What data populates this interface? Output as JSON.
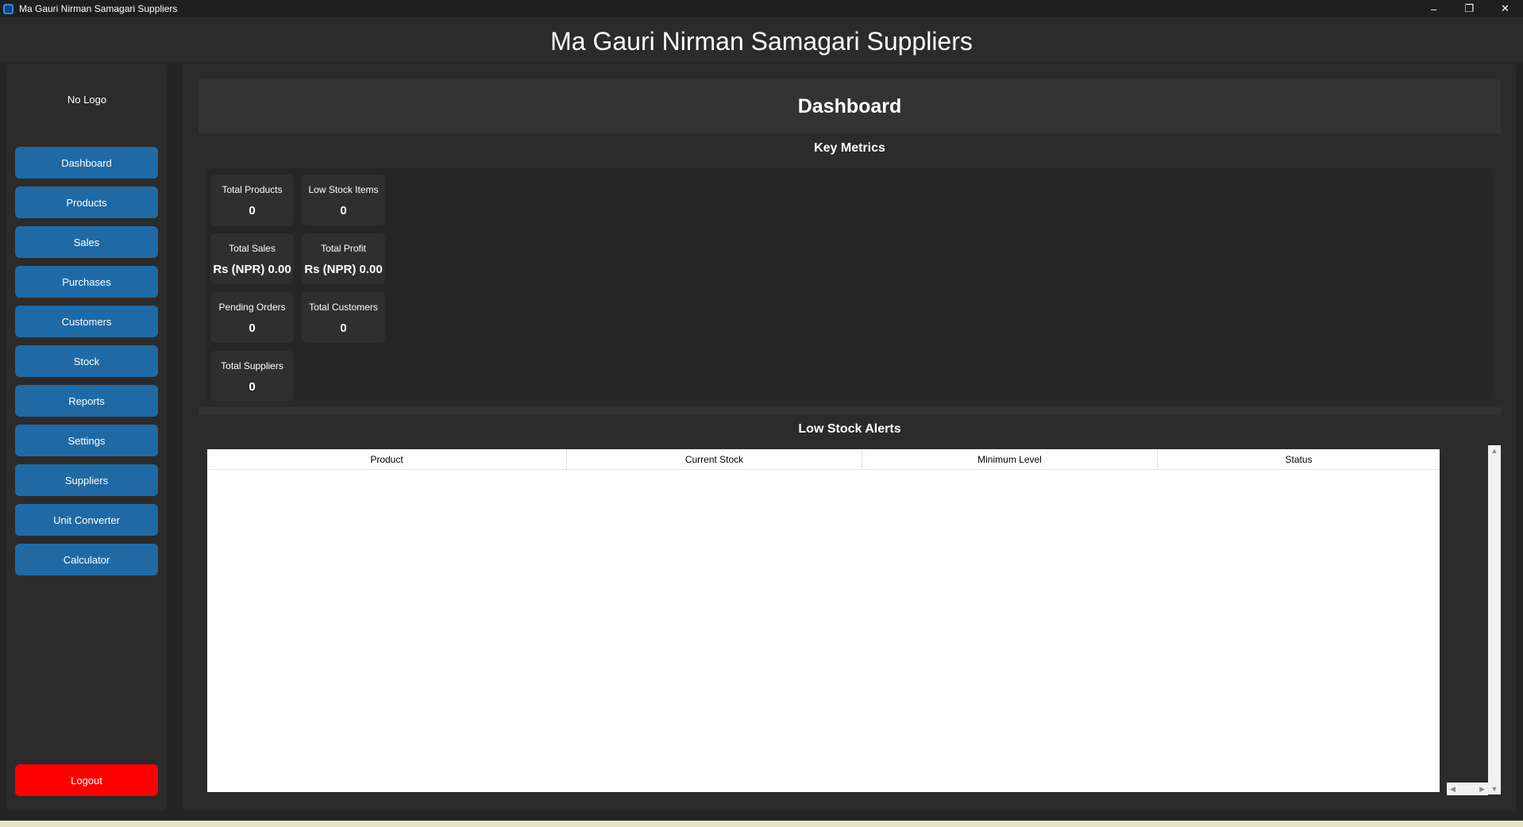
{
  "window": {
    "title": "Ma Gauri Nirman Samagari Suppliers",
    "controls": {
      "minimize": "–",
      "maximize": "❐",
      "close": "✕"
    }
  },
  "header": {
    "title": "Ma Gauri Nirman Samagari Suppliers"
  },
  "sidebar": {
    "logo_text": "No Logo",
    "items": [
      {
        "label": "Dashboard"
      },
      {
        "label": "Products"
      },
      {
        "label": "Sales"
      },
      {
        "label": "Purchases"
      },
      {
        "label": "Customers"
      },
      {
        "label": "Stock"
      },
      {
        "label": "Reports"
      },
      {
        "label": "Settings"
      },
      {
        "label": "Suppliers"
      },
      {
        "label": "Unit Converter"
      },
      {
        "label": "Calculator"
      }
    ],
    "logout_label": "Logout"
  },
  "dashboard": {
    "title": "Dashboard",
    "key_metrics_title": "Key Metrics",
    "metrics": {
      "total_products": {
        "label": "Total Products",
        "value": "0"
      },
      "low_stock_items": {
        "label": "Low Stock Items",
        "value": "0"
      },
      "total_sales": {
        "label": "Total Sales",
        "value": "Rs (NPR) 0.00"
      },
      "total_profit": {
        "label": "Total Profit",
        "value": "Rs (NPR) 0.00"
      },
      "pending_orders": {
        "label": "Pending Orders",
        "value": "0"
      },
      "total_customers": {
        "label": "Total Customers",
        "value": "0"
      },
      "total_suppliers": {
        "label": "Total Suppliers",
        "value": "0"
      }
    },
    "low_stock_title": "Low Stock Alerts",
    "table": {
      "columns": [
        "Product",
        "Current Stock",
        "Minimum Level",
        "Status"
      ],
      "rows": []
    }
  },
  "colors": {
    "nav_button": "#1f6aa5",
    "logout_button": "#ff0000",
    "background": "#242424",
    "panel": "#2b2b2b"
  }
}
